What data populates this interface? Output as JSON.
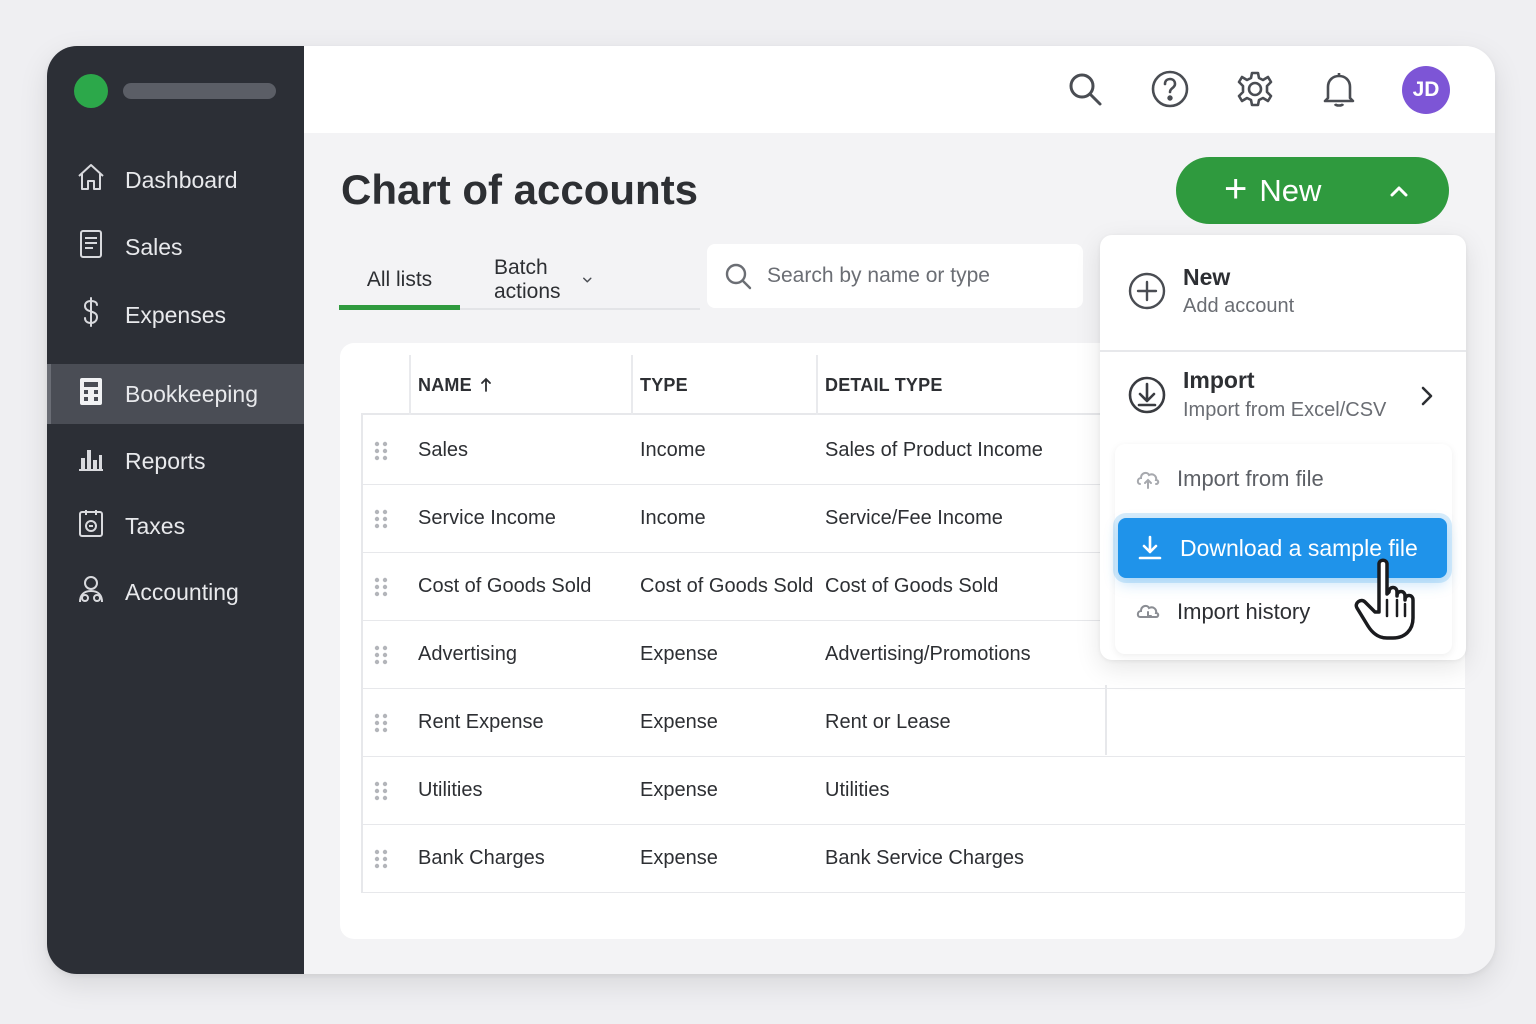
{
  "sidebar": {
    "items": [
      {
        "label": "Dashboard",
        "icon": "home-icon"
      },
      {
        "label": "Sales",
        "icon": "receipt-icon"
      },
      {
        "label": "Expenses",
        "icon": "dollar-icon"
      },
      {
        "label": "Bookkeeping",
        "icon": "calculator-icon",
        "active": true
      },
      {
        "label": "Reports",
        "icon": "bar-chart-icon"
      },
      {
        "label": "Taxes",
        "icon": "tax-icon"
      },
      {
        "label": "Accounting",
        "icon": "accountant-icon"
      }
    ]
  },
  "topbar": {
    "icons": [
      "search-icon",
      "help-icon",
      "gear-icon",
      "bell-icon"
    ],
    "avatar_initials": "JD"
  },
  "page": {
    "title": "Chart of accounts",
    "new_button": "New"
  },
  "tabs": {
    "all_lists": "All lists",
    "batch_actions": "Batch actions"
  },
  "search": {
    "placeholder": "Search by name or type"
  },
  "table": {
    "headers": {
      "name": "NAME",
      "type": "TYPE",
      "detail_type": "DETAIL TYPE"
    },
    "rows": [
      {
        "name": "Sales",
        "type": "Income",
        "detail": "Sales of Product Income"
      },
      {
        "name": "Service Income",
        "type": "Income",
        "detail": "Service/Fee Income"
      },
      {
        "name": "Cost of Goods Sold",
        "type": "Cost of Goods Sold",
        "detail": "Cost of Goods Sold"
      },
      {
        "name": "Advertising",
        "type": "Expense",
        "detail": "Advertising/Promotions"
      },
      {
        "name": "Rent Expense",
        "type": "Expense",
        "detail": "Rent or Lease"
      },
      {
        "name": "Utilities",
        "type": "Expense",
        "detail": "Utilities"
      },
      {
        "name": "Bank Charges",
        "type": "Expense",
        "detail": "Bank Service Charges"
      }
    ]
  },
  "menu": {
    "new_title": "New",
    "new_sub": "Add account",
    "import_title": "Import",
    "import_sub": "Import from Excel/CSV",
    "submenu": {
      "import_from_file": "Import from file",
      "download_sample": "Download a sample file",
      "import_history": "Import history"
    }
  },
  "colors": {
    "sidebar_bg": "#2c2f36",
    "brand_green": "#2ca84a",
    "primary_button": "#2f9a3e",
    "highlight_blue": "#1f93ea",
    "avatar_purple": "#7d55d6"
  }
}
